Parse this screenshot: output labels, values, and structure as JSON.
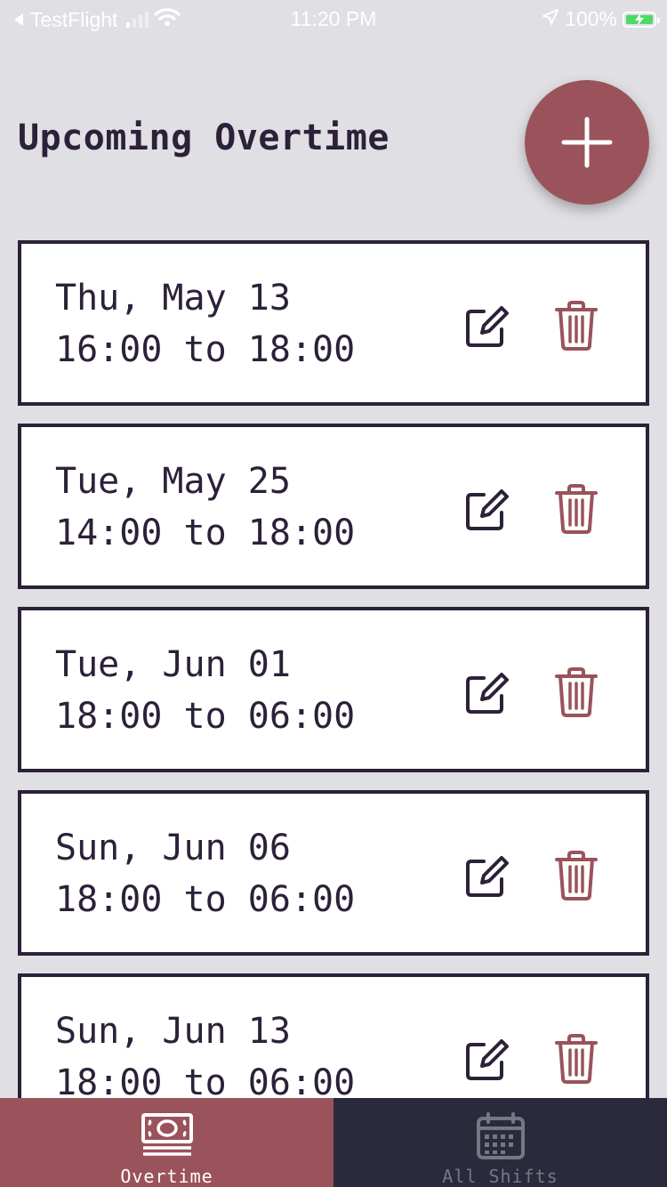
{
  "status_bar": {
    "back_app": "TestFlight",
    "time": "11:20 PM",
    "battery": "100%"
  },
  "header": {
    "title": "Upcoming Overtime",
    "add_icon": "plus-icon"
  },
  "overtime": [
    {
      "date": "Thu, May 13",
      "time": "16:00 to 18:00"
    },
    {
      "date": "Tue, May 25",
      "time": "14:00 to 18:00"
    },
    {
      "date": "Tue, Jun 01",
      "time": "18:00 to 06:00"
    },
    {
      "date": "Sun, Jun 06",
      "time": "18:00 to 06:00"
    },
    {
      "date": "Sun, Jun 13",
      "time": "18:00 to 06:00"
    }
  ],
  "tabs": [
    {
      "label": "Overtime",
      "icon": "money-icon",
      "active": true
    },
    {
      "label": "All Shifts",
      "icon": "calendar-icon",
      "active": false
    }
  ],
  "colors": {
    "accent": "#9a535b",
    "dark": "#2c2139",
    "background": "#e0dfe4",
    "tab_bar": "#2b2a3d"
  }
}
